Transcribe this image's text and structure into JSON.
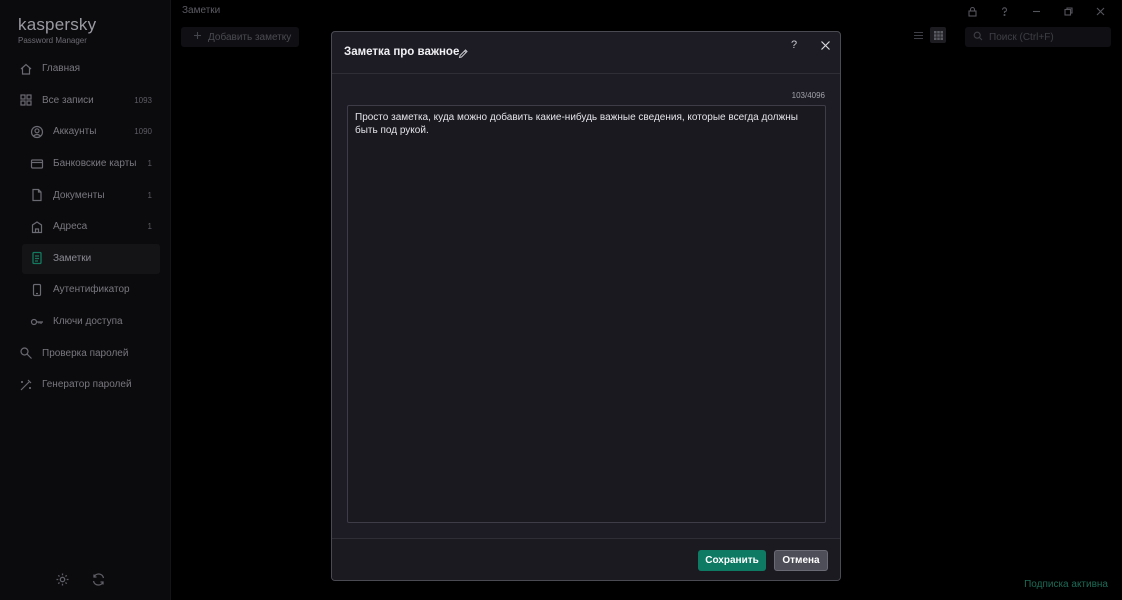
{
  "app": {
    "brand_name": "kaspersky",
    "brand_sub": "Password Manager",
    "accent": "#0f7a64"
  },
  "sidebar": {
    "items": [
      {
        "label": "Главная",
        "icon": "home-icon",
        "count": ""
      },
      {
        "label": "Все записи",
        "icon": "grid-icon",
        "count": "1093"
      },
      {
        "label": "Аккаунты",
        "icon": "user-icon",
        "count": "1090"
      },
      {
        "label": "Банковские карты",
        "icon": "card-icon",
        "count": "1"
      },
      {
        "label": "Документы",
        "icon": "document-icon",
        "count": "1"
      },
      {
        "label": "Адреса",
        "icon": "building-icon",
        "count": "1"
      },
      {
        "label": "Заметки",
        "icon": "note-icon",
        "count": ""
      },
      {
        "label": "Аутентификатор",
        "icon": "authenticator-icon",
        "count": ""
      },
      {
        "label": "Ключи доступа",
        "icon": "key-icon",
        "count": ""
      },
      {
        "label": "Проверка паролей",
        "icon": "password-check-icon",
        "count": ""
      },
      {
        "label": "Генератор паролей",
        "icon": "password-generator-icon",
        "count": ""
      }
    ],
    "active": "Заметки"
  },
  "main": {
    "section_title": "Заметки",
    "add_button": "Добавить заметку",
    "search_placeholder": "Поиск (Ctrl+F)",
    "status": "Подписка активна"
  },
  "modal": {
    "title": "Заметка про важное",
    "help": "?",
    "counter": "103/4096",
    "note_text": "Просто заметка, куда можно добавить какие-нибудь важные сведения, которые всегда должны быть под рукой.",
    "save_label": "Сохранить",
    "cancel_label": "Отмена"
  }
}
